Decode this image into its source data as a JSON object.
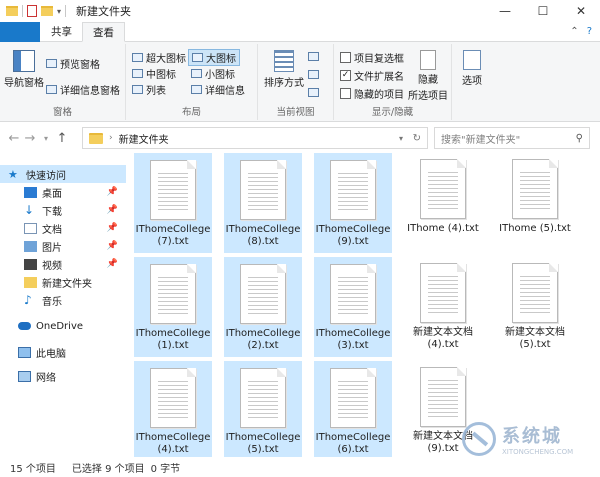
{
  "window": {
    "title": "新建文件夹",
    "minimize": "—",
    "maximize": "☐",
    "close": "✕"
  },
  "ribbon_tabs": [
    "文件",
    "主页",
    "共享",
    "查看"
  ],
  "ribbon_right": {
    "collapse": "⌃",
    "help": "?"
  },
  "ribbon": {
    "pane": {
      "nav_pane": "导航窗格",
      "preview_pane": "预览窗格",
      "details_pane": "详细信息窗格",
      "label": "窗格"
    },
    "layout": {
      "xlarge": "超大图标",
      "large": "大图标",
      "medium": "中图标",
      "small": "小图标",
      "list": "列表",
      "details": "详细信息",
      "label": "布局"
    },
    "current_view": {
      "sort_by": "排序方式",
      "label": "当前视图"
    },
    "show_hide": {
      "item_checkboxes": "项目复选框",
      "file_extensions": "文件扩展名",
      "hidden_items": "隐藏的项目",
      "hide_selected_1": "隐藏",
      "hide_selected_2": "所选项目",
      "label": "显示/隐藏"
    },
    "options": {
      "label": "选项"
    }
  },
  "address": {
    "path": "新建文件夹"
  },
  "search": {
    "placeholder": "搜索\"新建文件夹\""
  },
  "nav": {
    "quick_access": "快速访问",
    "desktop": "桌面",
    "downloads": "下载",
    "documents": "文档",
    "pictures": "图片",
    "videos": "视频",
    "new_folder": "新建文件夹",
    "music": "音乐",
    "onedrive": "OneDrive",
    "this_pc": "此电脑",
    "network": "网络"
  },
  "files": [
    {
      "name": "IThomeCollege (7).txt",
      "selected": true
    },
    {
      "name": "IThomeCollege (8).txt",
      "selected": true
    },
    {
      "name": "IThomeCollege (9).txt",
      "selected": true
    },
    {
      "name": "IThome (4).txt",
      "selected": false
    },
    {
      "name": "IThome (5).txt",
      "selected": false
    },
    {
      "name": "IThomeCollege (1).txt",
      "selected": true
    },
    {
      "name": "IThomeCollege (2).txt",
      "selected": true
    },
    {
      "name": "IThomeCollege (3).txt",
      "selected": true
    },
    {
      "name": "新建文本文档 (4).txt",
      "selected": false
    },
    {
      "name": "新建文本文档 (5).txt",
      "selected": false
    },
    {
      "name": "IThomeCollege (4).txt",
      "selected": true
    },
    {
      "name": "IThomeCollege (5).txt",
      "selected": true
    },
    {
      "name": "IThomeCollege (6).txt",
      "selected": true
    },
    {
      "name": "新建文本文档 (9).txt",
      "selected": false
    }
  ],
  "status": {
    "item_count": "15 个项目",
    "selected": "已选择 9 个项目",
    "size": "0 字节"
  },
  "watermark": {
    "main": "系统城",
    "sub": "XITONGCHENG.COM"
  }
}
